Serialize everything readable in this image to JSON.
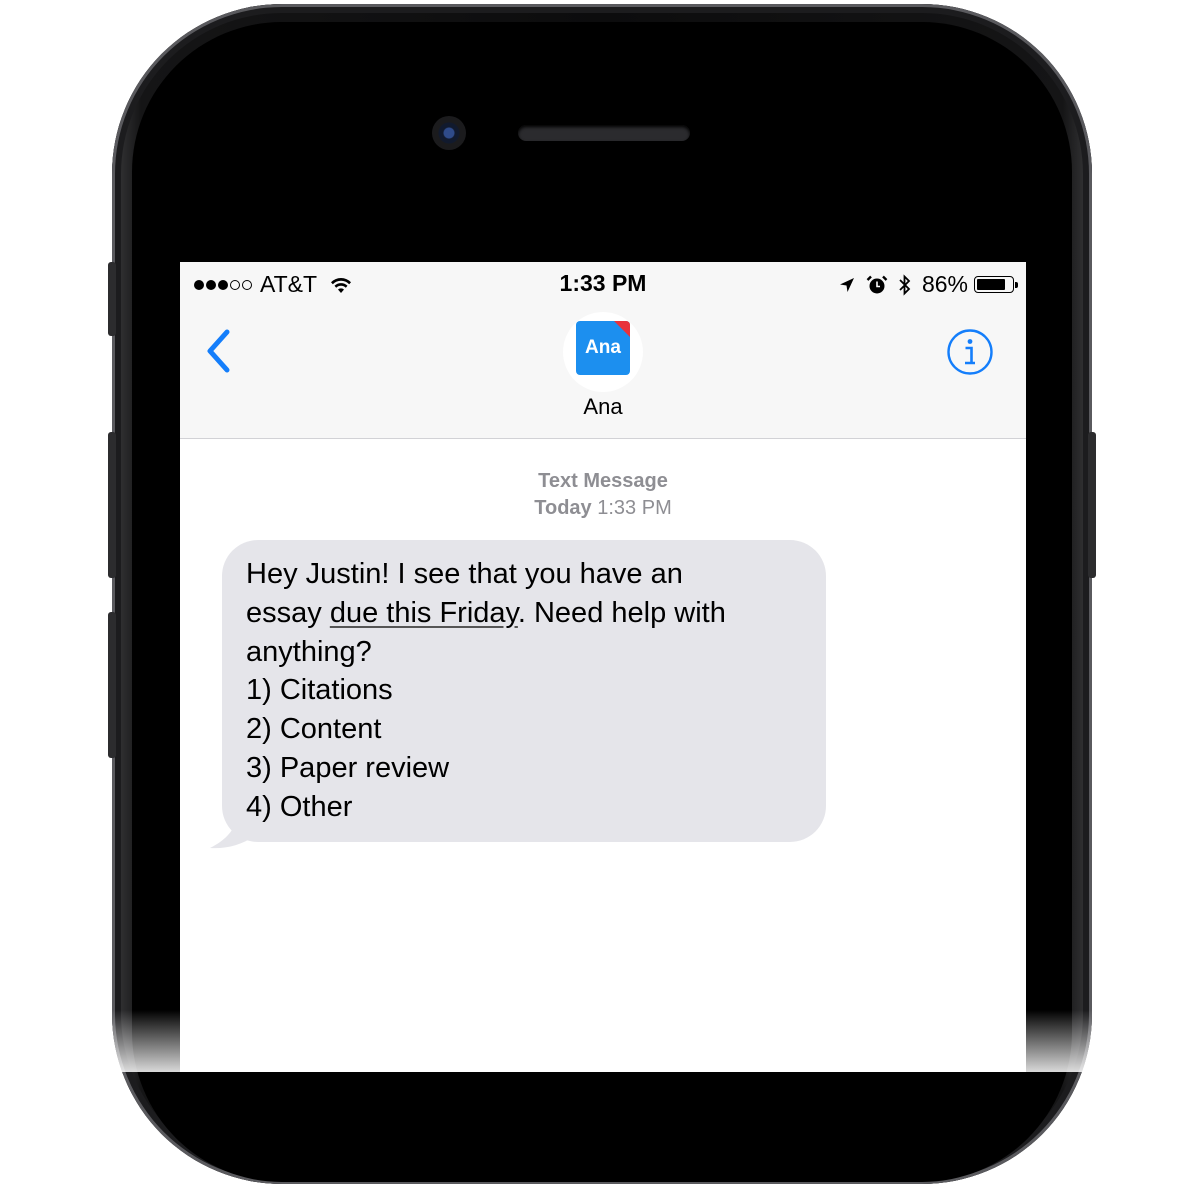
{
  "status_bar": {
    "carrier": "AT&T",
    "signal_bars_filled": 3,
    "signal_bars_total": 5,
    "time": "1:33 PM",
    "battery_percent": "86%",
    "battery_level": 0.86,
    "icons": [
      "wifi-icon",
      "location-arrow-icon",
      "alarm-icon",
      "bluetooth-icon",
      "battery-icon"
    ]
  },
  "header": {
    "back_icon": "chevron-left-icon",
    "contact_avatar_text": "Ana",
    "contact_name": "Ana",
    "info_icon": "info-icon"
  },
  "conversation": {
    "meta_type": "Text Message",
    "meta_day": "Today",
    "meta_time": "1:33 PM",
    "message": {
      "line1": "Hey Justin! I see that you have an",
      "line2_pre": "essay ",
      "line2_link": "due this Friday",
      "line2_post": ". Need help with",
      "line3": "anything?",
      "options": [
        "1) Citations",
        "2) Content",
        "3) Paper review",
        "4) Other"
      ]
    }
  },
  "colors": {
    "accent": "#147efb",
    "bubble": "#e5e5ea",
    "avatar": "#1c8fef",
    "avatar_corner": "#e8323c",
    "meta_text": "#8e8e93"
  }
}
